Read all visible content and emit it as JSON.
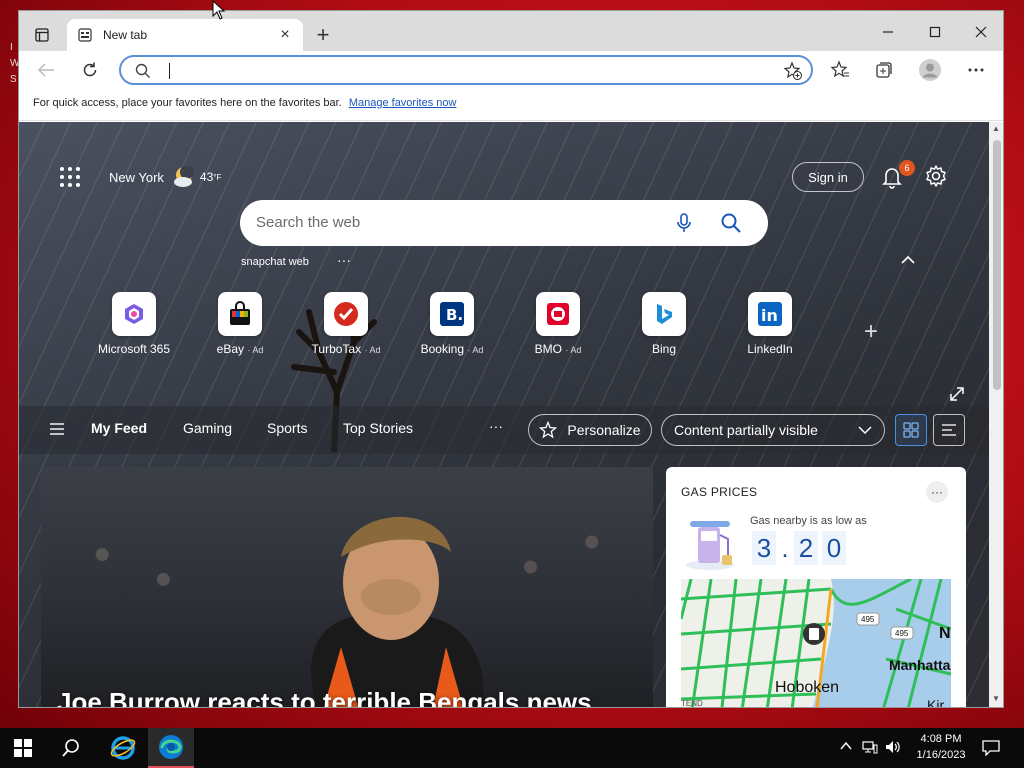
{
  "desktop": {
    "side_text": [
      "I",
      "W",
      "S"
    ]
  },
  "browser": {
    "tab": {
      "title": "New tab"
    },
    "address": {
      "value": ""
    },
    "favorites_bar": {
      "message": "For quick access, place your favorites here on the favorites bar.",
      "link": "Manage favorites now"
    }
  },
  "ntp": {
    "weather": {
      "city": "New York",
      "temp": "43",
      "unit": "°F"
    },
    "sign_in": "Sign in",
    "notifications_count": "6",
    "search": {
      "placeholder": "Search the web"
    },
    "trending": "snapchat web",
    "tiles": [
      {
        "label": "Microsoft 365",
        "ad": ""
      },
      {
        "label": "eBay",
        "ad": "· Ad"
      },
      {
        "label": "TurboTax",
        "ad": "· Ad"
      },
      {
        "label": "Booking",
        "ad": "· Ad"
      },
      {
        "label": "BMO",
        "ad": "· Ad"
      },
      {
        "label": "Bing",
        "ad": ""
      },
      {
        "label": "LinkedIn",
        "ad": ""
      }
    ],
    "feed_nav": {
      "items": [
        "My Feed",
        "Gaming",
        "Sports",
        "Top Stories"
      ],
      "more": "···",
      "personalize": "Personalize",
      "content_visibility": "Content partially visible"
    },
    "hero": {
      "headline": "Joe Burrow reacts to terrible Bengals news"
    },
    "gas": {
      "title": "GAS PRICES",
      "subtitle": "Gas nearby is as low as",
      "digits": [
        "3",
        ".",
        "2",
        "0"
      ],
      "map_labels": [
        "Hoboken",
        "Manhatta",
        "495",
        "495",
        "N",
        "Kir",
        "TEND"
      ]
    }
  },
  "taskbar": {
    "time": "4:08 PM",
    "date": "1/16/2023"
  },
  "colors": {
    "accent": "#0078d4",
    "desktop_red": "#c8101a",
    "badge": "#e0561e",
    "price_blue": "#1e4f9c"
  }
}
